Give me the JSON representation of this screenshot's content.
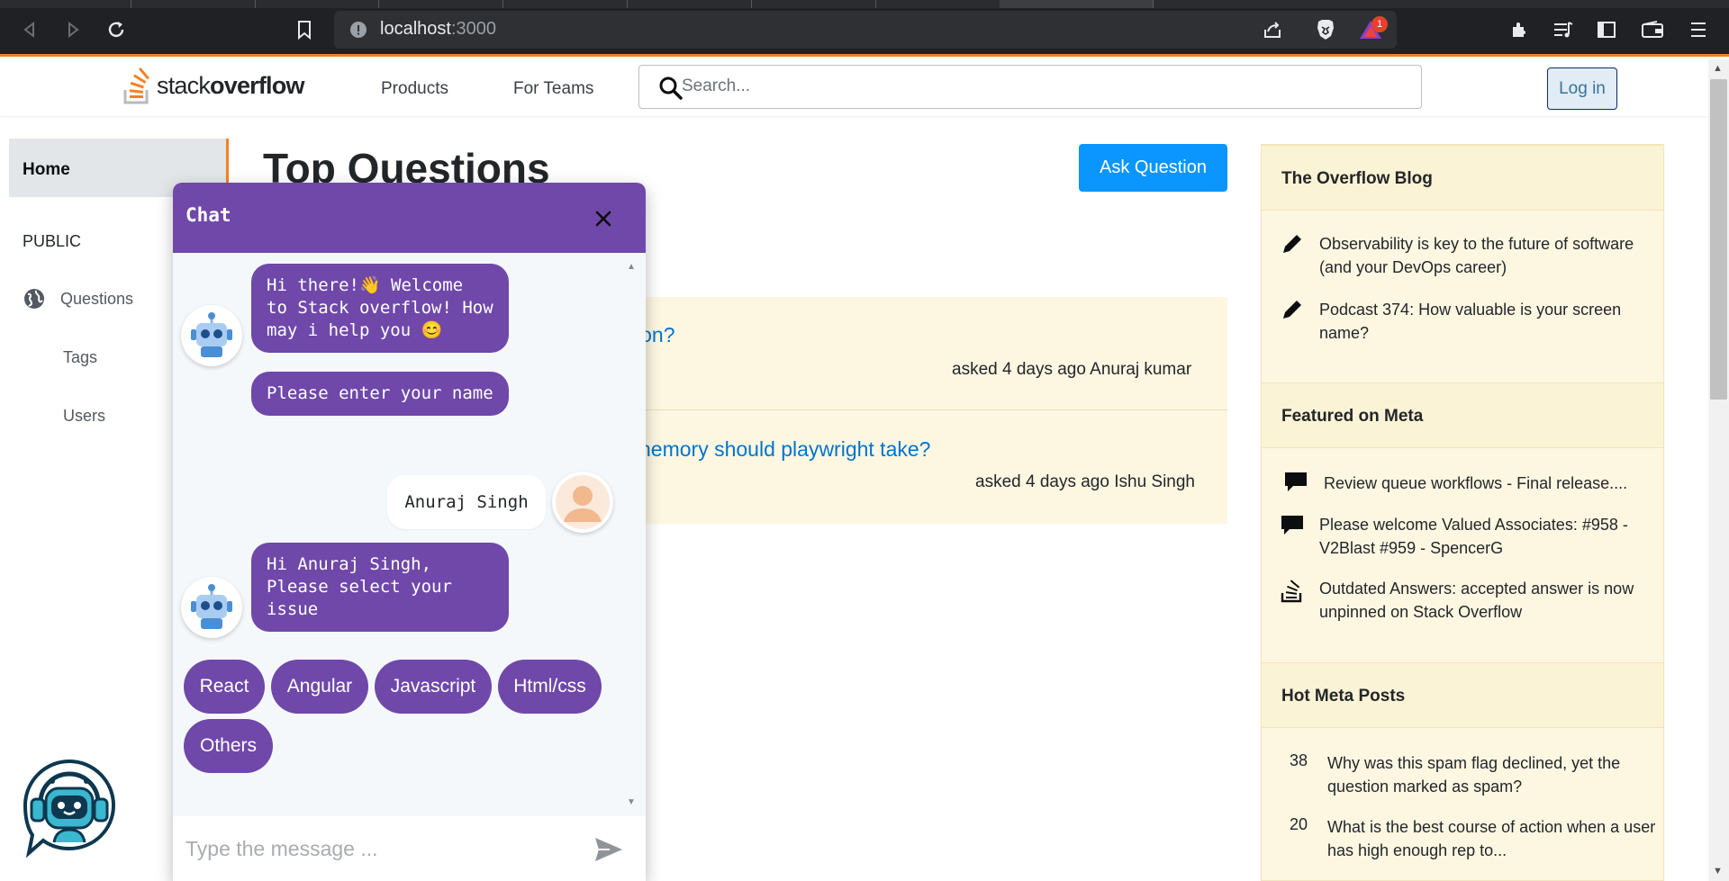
{
  "browser": {
    "url_host": "localhost",
    "url_port": ":3000",
    "notification_count": "1"
  },
  "header": {
    "logo_prefix": "stack",
    "logo_suffix": "overflow",
    "nav": [
      "Products",
      "For Teams"
    ],
    "search_placeholder": "Search...",
    "login_label": "Log in"
  },
  "sidebar": {
    "home": "Home",
    "section": "PUBLIC",
    "items": [
      "Questions",
      "Tags",
      "Users"
    ]
  },
  "main": {
    "title": "Top Questions",
    "ask_button": "Ask Question",
    "questions": [
      {
        "title": "ion?",
        "meta": "asked 4 days ago Anuraj kumar"
      },
      {
        "title": "hemory should playwright take?",
        "meta": "asked 4 days ago Ishu Singh"
      }
    ]
  },
  "blog": {
    "title": "The Overflow Blog",
    "items": [
      "Observability is key to the future of software (and your DevOps career)",
      "Podcast 374: How valuable is your screen name?"
    ]
  },
  "meta": {
    "title": "Featured on Meta",
    "items": [
      "Review queue workflows - Final release....",
      "Please welcome Valued Associates: #958 - V2Blast #959 - SpencerG",
      "Outdated Answers: accepted answer is now unpinned on Stack Overflow"
    ]
  },
  "hot": {
    "title": "Hot Meta Posts",
    "items": [
      {
        "count": "38",
        "text": "Why was this spam flag declined, yet the question marked as spam?"
      },
      {
        "count": "20",
        "text": "What is the best course of action when a user has high enough rep to..."
      }
    ]
  },
  "chat": {
    "title": "Chat",
    "messages": [
      "Hi there!👋 Welcome to Stack overflow! How may i help you 😊",
      "Please enter your name",
      "Anuraj Singh",
      "Hi Anuraj Singh, Please select your issue"
    ],
    "options": [
      "React",
      "Angular",
      "Javascript",
      "Html/css",
      "Others"
    ],
    "input_placeholder": "Type the message ..."
  },
  "colors": {
    "chat_purple": "#6f48aa",
    "so_orange": "#f48024",
    "ask_blue": "#0a95ff",
    "widget_yellow": "#fdf7e2"
  }
}
